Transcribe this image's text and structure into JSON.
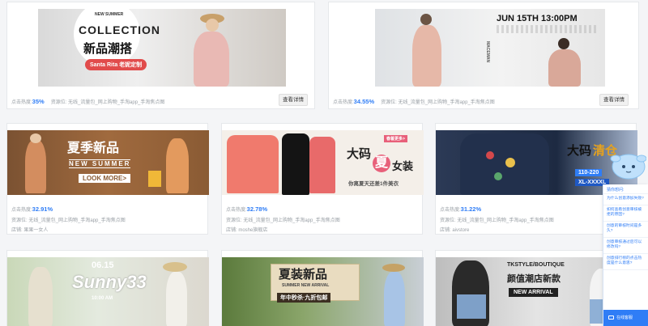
{
  "labels": {
    "heat": "点击热度:",
    "view_details": "查看详情"
  },
  "cards": [
    {
      "heat": "35%",
      "source": "资源位: 无线_流量包_网上购物_手淘app_手淘焦点图",
      "banner_text": [
        "NEW SUMMER",
        "COLLECTION",
        "新品潮搭",
        "Santa Rita 老妮定制"
      ]
    },
    {
      "heat": "34.55%",
      "source": "资源位: 无线_流量包_网上购物_手淘app_手淘焦点图",
      "banner_text": [
        "JUN 15TH 13:00PM",
        "MACEMAN"
      ]
    },
    {
      "heat": "32.91%",
      "source": "资源位: 无线_流量包_网上购物_手淘app_手淘焦点图",
      "shop": "店铺: 果果一女人",
      "banner_text": [
        "夏季新品",
        "NEW SUMMER",
        "LOOK MORE>"
      ]
    },
    {
      "heat": "32.78%",
      "source": "资源位: 无线_流量包_网上购物_手淘app_手淘焦点图",
      "shop": "店铺: moshe旗舰店",
      "banner_text": [
        "春着更多>",
        "大码",
        "夏",
        "女装",
        "你离夏天还差1件美衣"
      ]
    },
    {
      "heat": "31.22%",
      "source": "资源位: 无线_流量包_网上购物_手淘app_手淘焦点图",
      "shop": "店铺: aivstore",
      "banner_text": [
        "大码",
        "清仓",
        "110-220",
        "XL-XXXXL"
      ]
    },
    {
      "banner_text": [
        "06.15",
        "Sunny33",
        "10:00 AM"
      ]
    },
    {
      "banner_text": [
        "夏装新品",
        "SUMMER NEW ARRIVAL",
        "年中秒杀·九折包邮"
      ]
    },
    {
      "banner_text": [
        "TKSTYLE/BOUTIQUE",
        "颜值潮店新款",
        "NEW ARRIVAL"
      ]
    }
  ],
  "help": {
    "title": "猜你想问:",
    "questions": [
      "为什么创意添加失败?",
      "如何查看创意审核被拒的原因?",
      "创意的审核时间是多久?",
      "创意审核通过后可以修改吗?",
      "创意排行榜的点击热度是什么意思?"
    ],
    "footer": "在线客服"
  },
  "colors": {
    "accent": "#2f7df6",
    "button_bg": "#f1f1f1"
  }
}
